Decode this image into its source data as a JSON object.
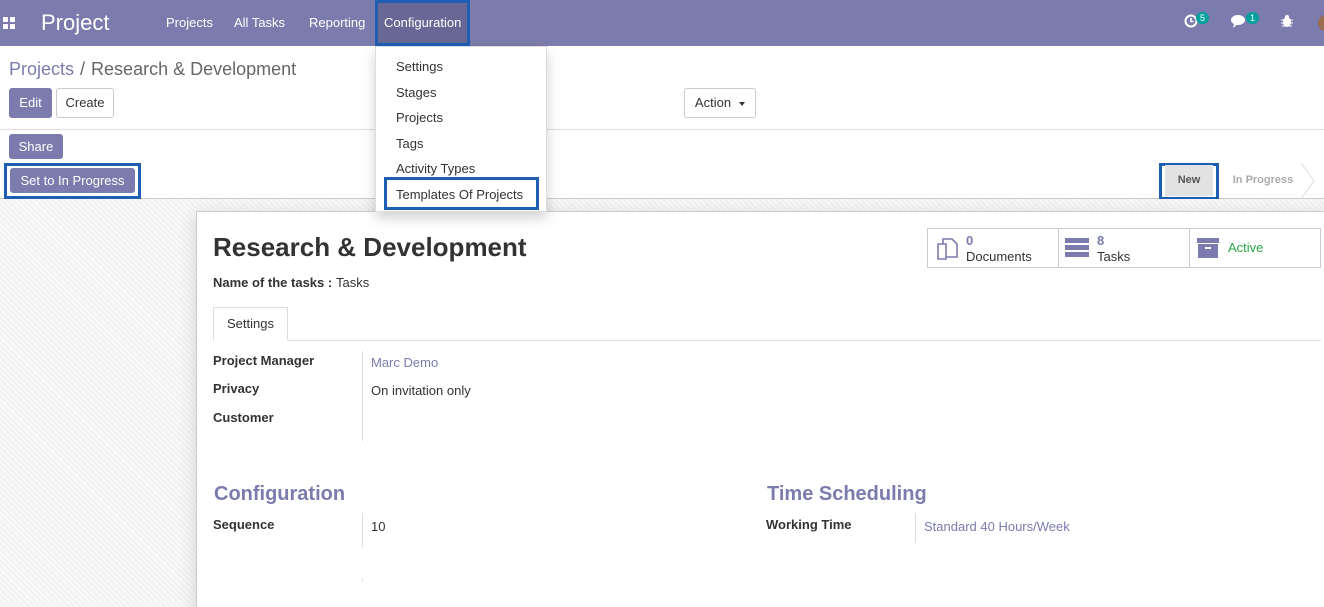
{
  "navbar": {
    "brand": "Project",
    "menus": [
      "Projects",
      "All Tasks",
      "Reporting",
      "Configuration"
    ],
    "activities_count": "5",
    "messages_count": "1"
  },
  "config_menu": [
    "Settings",
    "Stages",
    "Projects",
    "Tags",
    "Activity Types",
    "Templates Of Projects"
  ],
  "breadcrumb": {
    "parent": "Projects",
    "separator": "/",
    "current": "Research & Development"
  },
  "buttons": {
    "edit": "Edit",
    "create": "Create",
    "action": "Action",
    "share": "Share",
    "set_progress": "Set to In Progress"
  },
  "stages": [
    "New",
    "In Progress"
  ],
  "record": {
    "title": "Research & Development",
    "tasks_name_label": "Name of the tasks :",
    "tasks_name_value": "Tasks",
    "stats": [
      {
        "num": "0",
        "label": "Documents"
      },
      {
        "num": "8",
        "label": "Tasks"
      },
      {
        "label": "Active"
      }
    ],
    "tab": "Settings",
    "fields": {
      "project_manager_label": "Project Manager",
      "project_manager_value": "Marc Demo",
      "privacy_label": "Privacy",
      "privacy_value": "On invitation only",
      "customer_label": "Customer"
    },
    "configuration_title": "Configuration",
    "sequence_label": "Sequence",
    "sequence_value": "10",
    "time_title": "Time Scheduling",
    "working_time_label": "Working Time",
    "working_time_value": "Standard 40 Hours/Week"
  },
  "colors": {
    "brand": "#7c7bad",
    "highlight": "#1e5fb3",
    "active": "#28a745"
  }
}
